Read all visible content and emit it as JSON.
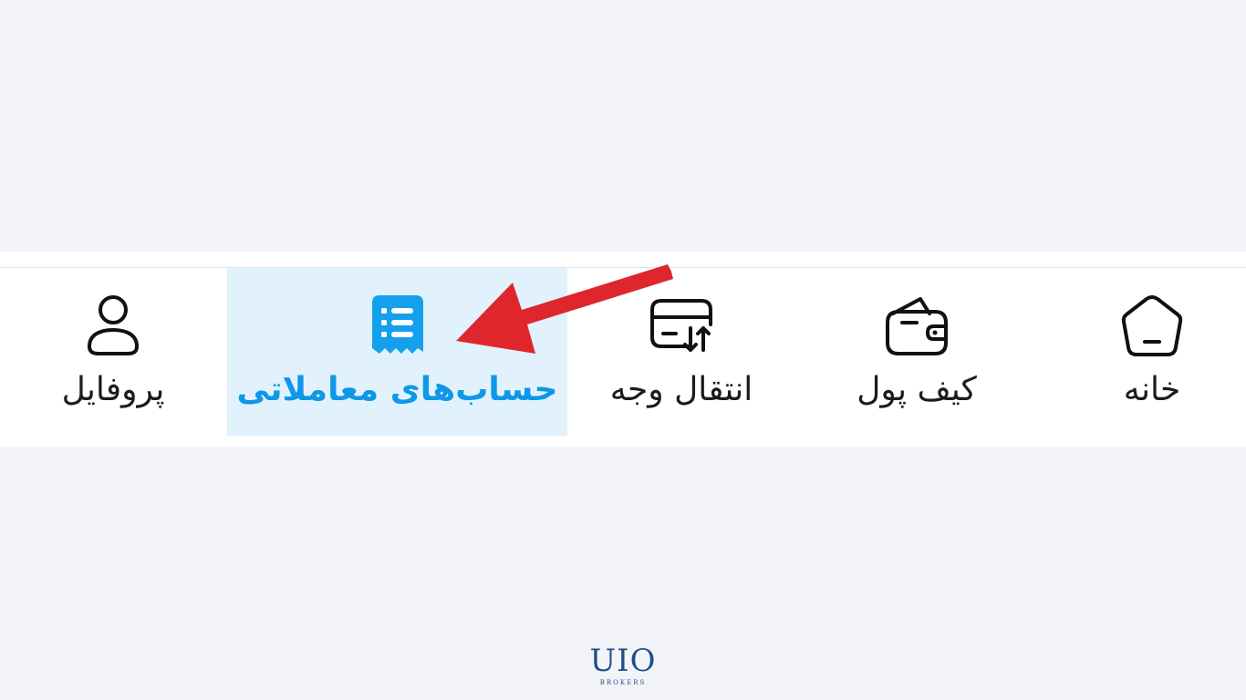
{
  "nav": {
    "profile_label": "پروفایل",
    "accounts_label": "حساب‌های معاملاتی",
    "transfer_label": "انتقال وجه",
    "wallet_label": "کیف پول",
    "home_label": "خانه",
    "active_item": "accounts"
  },
  "icons": {
    "profile": "user-icon",
    "accounts": "receipt-list-icon",
    "transfer": "card-transfer-icon",
    "wallet": "wallet-icon",
    "home": "home-icon"
  },
  "colors": {
    "active_accent": "#0f97e8",
    "active_background": "#e1f2fd",
    "arrow": "#e0262d",
    "page_background": "#f2f4f8"
  },
  "logo": {
    "main": "UIO",
    "sub": "BROKERS"
  }
}
